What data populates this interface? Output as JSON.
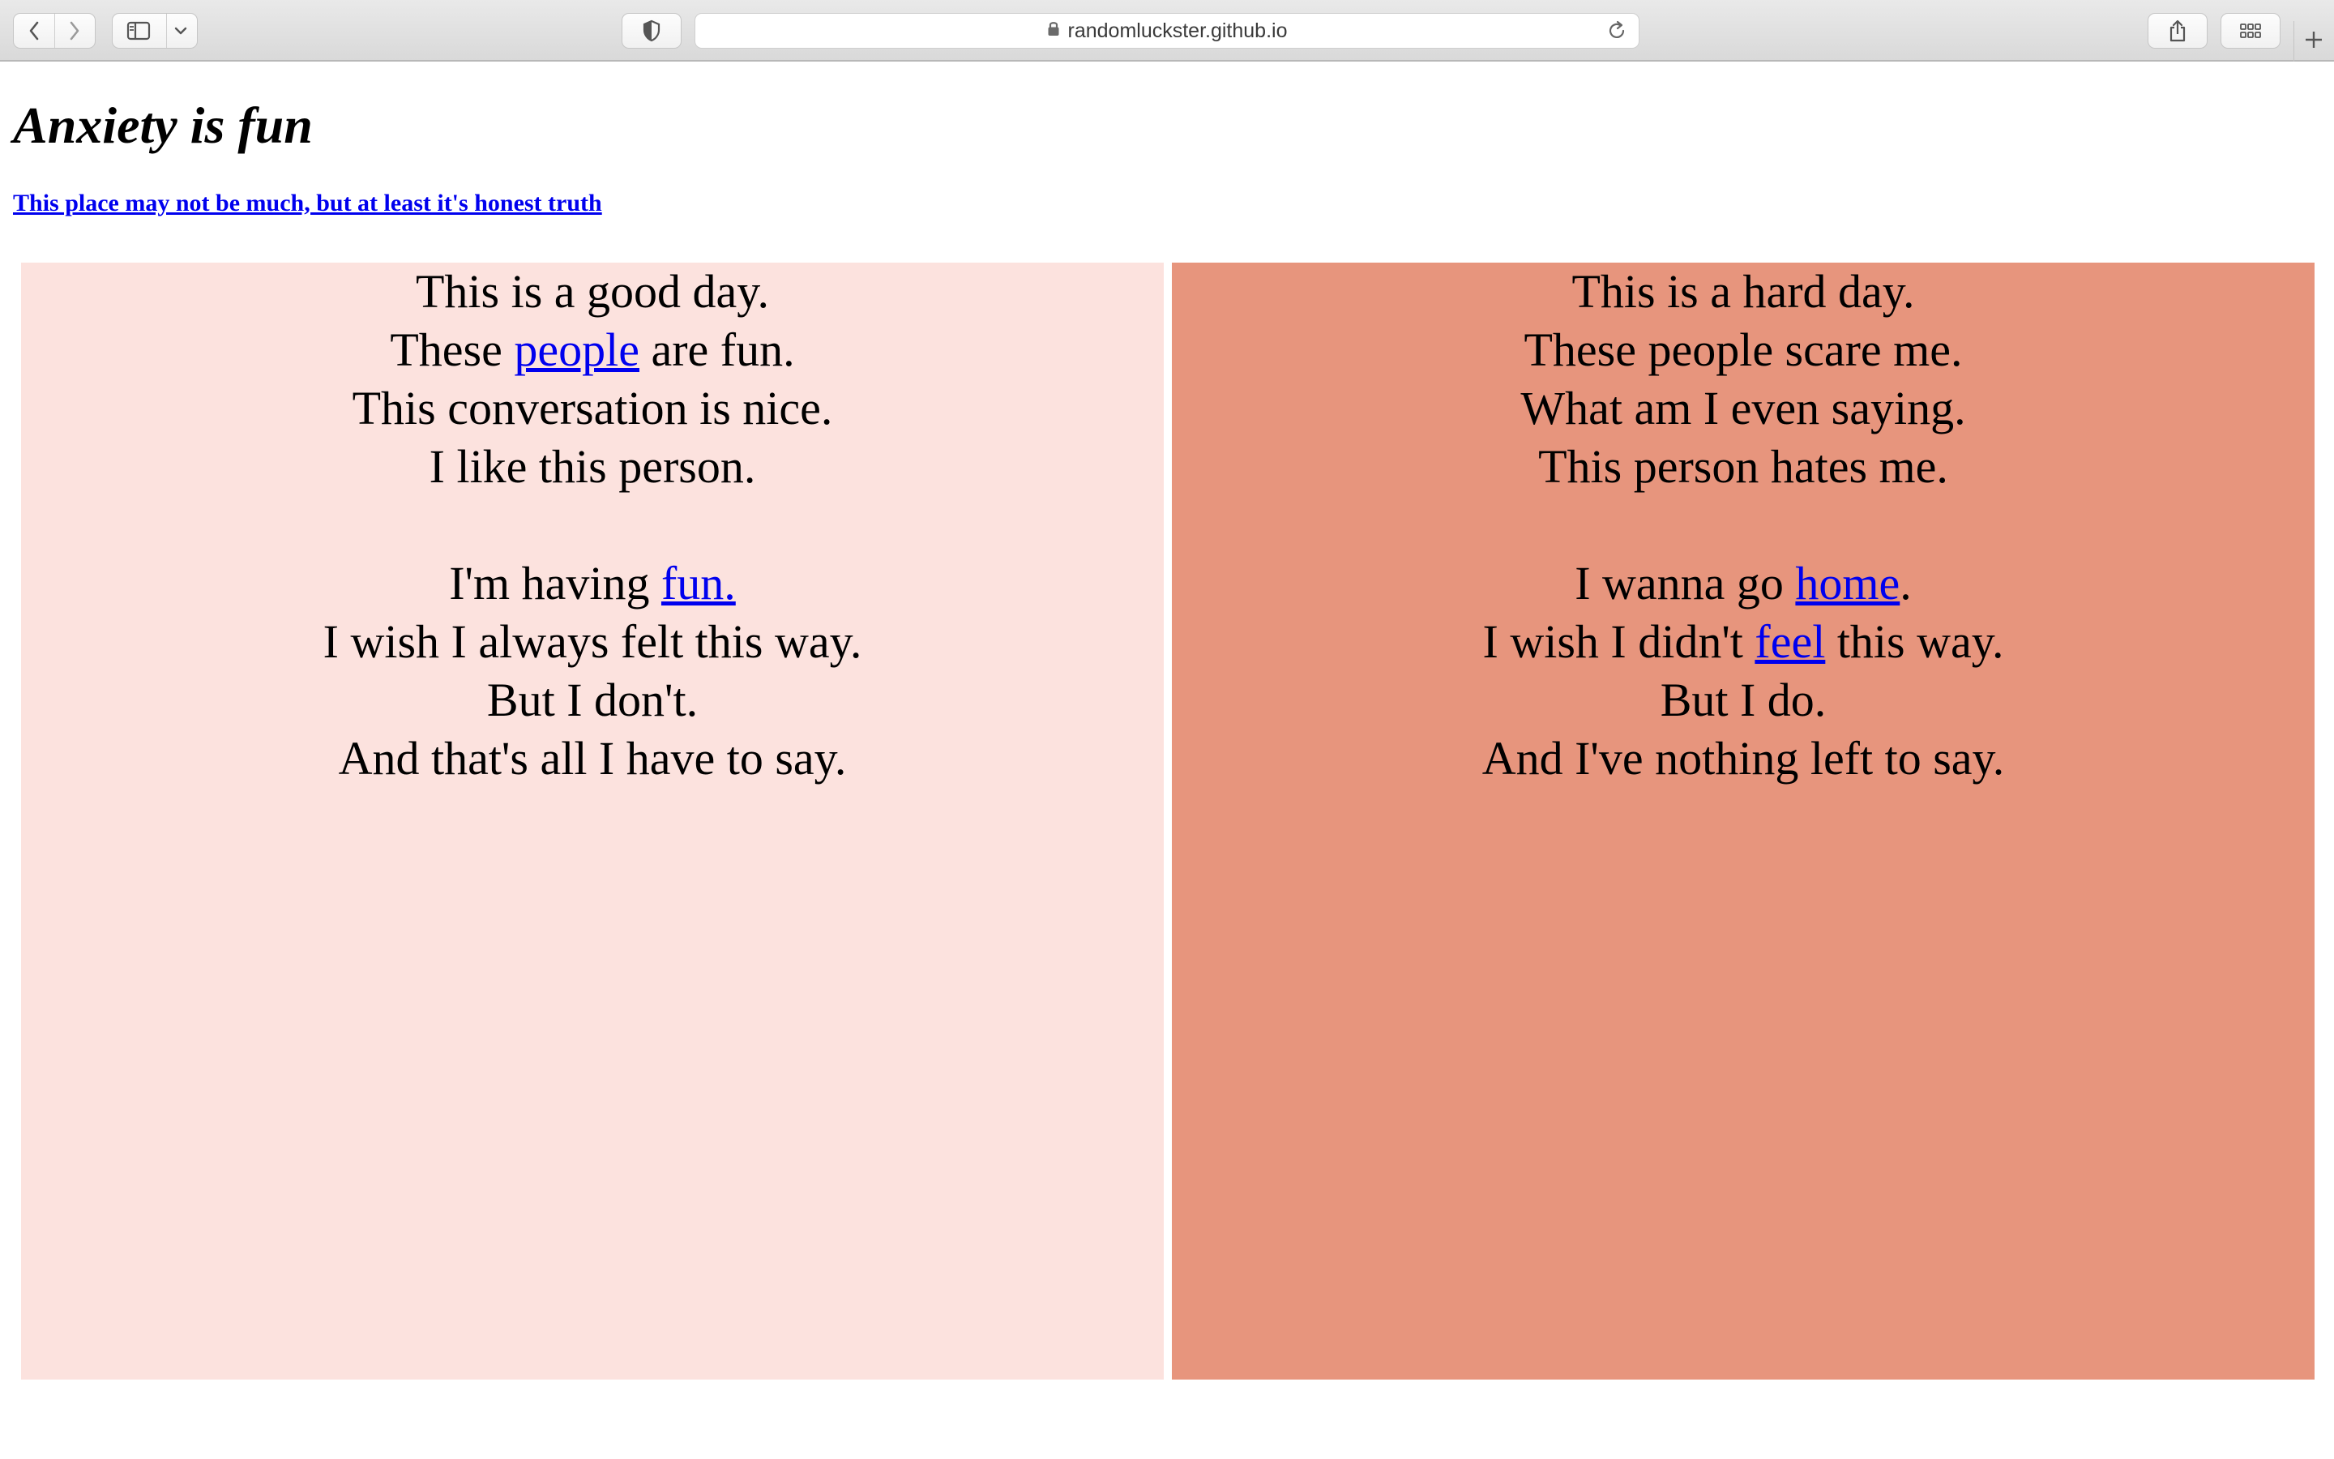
{
  "browser": {
    "url": "randomluckster.github.io",
    "icons": [
      "back-icon",
      "forward-icon",
      "sidebar-icon",
      "chevron-down-icon",
      "shield-icon",
      "lock-icon",
      "reload-icon",
      "share-icon",
      "tab-overview-icon",
      "plus-icon"
    ]
  },
  "header": {
    "title": "Anxiety is fun",
    "subtitle": "This place may not be much, but at least it's honest truth"
  },
  "good_day": {
    "background": "#fce2de",
    "line1": "This is a good day.",
    "line2_before": "These ",
    "line2_link": "people",
    "line2_after": " are fun.",
    "line3": "This conversation is nice.",
    "line4": "I like this person.",
    "line5_before": "I'm having ",
    "line5_link": "fun.",
    "line6": "I wish I always felt this way.",
    "line7": "But I don't.",
    "line8": "And that's all I have to say."
  },
  "hard_day": {
    "background": "#e7957d",
    "line1": "This is a hard day.",
    "line2": "These people scare me.",
    "line3": "What am I even saying.",
    "line4": "This person hates me.",
    "line5_before": "I wanna go ",
    "line5_link": "home",
    "line5_after": ".",
    "line6_before": "I wish I didn't ",
    "line6_link": "feel",
    "line6_after": " this way.",
    "line7": "But I do.",
    "line8": "And I've nothing left to say."
  },
  "colors": {
    "link": "#0000ee",
    "text": "#000000"
  }
}
